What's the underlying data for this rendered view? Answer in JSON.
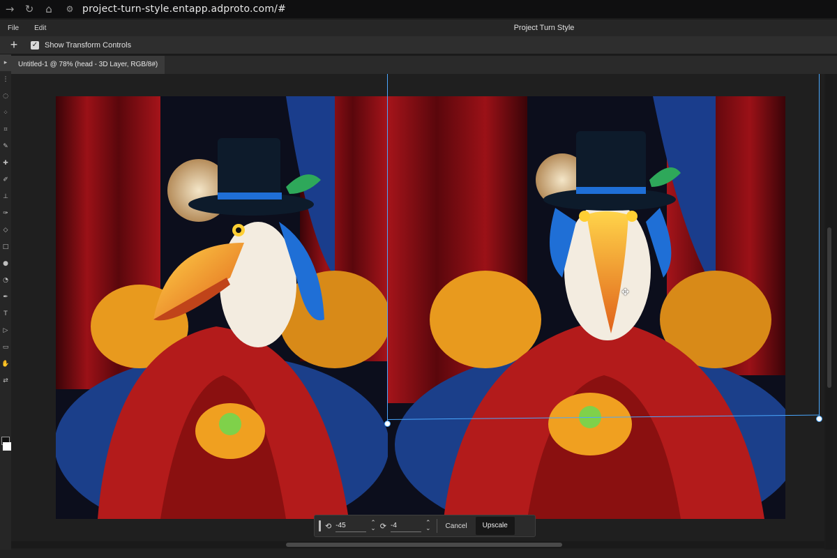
{
  "browser": {
    "url": "project-turn-style.entapp.adproto.com/#",
    "back_icon": "arrow-right-icon",
    "reload_icon": "reload-icon",
    "home_icon": "home-icon",
    "site_info_icon": "tune-icon"
  },
  "menu": {
    "items": [
      "File",
      "Edit"
    ],
    "app_title": "Project Turn Style"
  },
  "options": {
    "show_transform_controls_label": "Show Transform Controls",
    "show_transform_controls_checked": true
  },
  "document": {
    "tab_title": "Untitled-1 @ 78% (head - 3D Layer, RGB/8#)"
  },
  "floating_toolbar": {
    "rotate_value_1": "-45",
    "rotate_value_2": "-4",
    "cancel_label": "Cancel",
    "upscale_label": "Upscale"
  },
  "colors": {
    "guide": "#4aa8ff",
    "curtain": "#8a0f14",
    "jacket": "#b31b1b",
    "beak": "#f29a1d",
    "feathers": "#1f6fd6",
    "foreground_swatch": "#111111",
    "background_swatch": "#ffffff"
  }
}
